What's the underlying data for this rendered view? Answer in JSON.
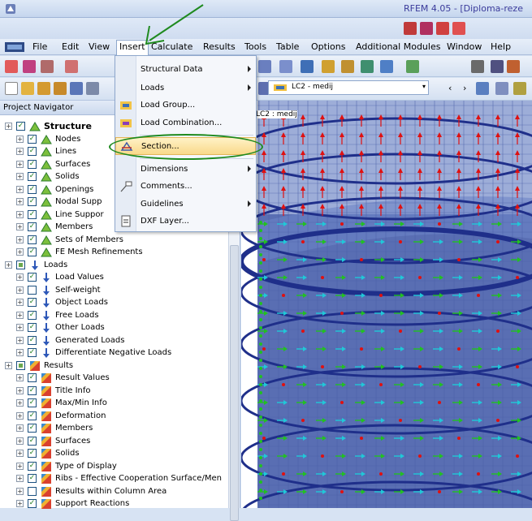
{
  "window": {
    "title": "RFEM 4.05 - [Diploma-reze"
  },
  "menubar": {
    "items": [
      {
        "label": "File"
      },
      {
        "label": "Edit"
      },
      {
        "label": "View"
      },
      {
        "label": "Insert"
      },
      {
        "label": "Calculate"
      },
      {
        "label": "Results"
      },
      {
        "label": "Tools"
      },
      {
        "label": "Table"
      },
      {
        "label": "Options"
      },
      {
        "label": "Additional Modules"
      },
      {
        "label": "Window"
      },
      {
        "label": "Help"
      }
    ]
  },
  "toolbar": {
    "load_case": "LC2 - medij"
  },
  "insert_menu": {
    "items": [
      {
        "label": "Structural Data",
        "submenu": true
      },
      {
        "label": "Loads",
        "submenu": true
      },
      {
        "label": "Load Group..."
      },
      {
        "label": "Load Combination..."
      },
      {
        "label": "Section..."
      },
      {
        "label": "Dimensions",
        "submenu": true
      },
      {
        "label": "Comments..."
      },
      {
        "label": "Guidelines",
        "submenu": true
      },
      {
        "label": "DXF Layer..."
      }
    ]
  },
  "navigator": {
    "title": "Project Navigator",
    "tree": [
      {
        "label": "Structure",
        "level": 0,
        "bold": true
      },
      {
        "label": "Nodes",
        "level": 1
      },
      {
        "label": "Lines",
        "level": 1
      },
      {
        "label": "Surfaces",
        "level": 1
      },
      {
        "label": "Solids",
        "level": 1
      },
      {
        "label": "Openings",
        "level": 1
      },
      {
        "label": "Nodal Supp",
        "level": 1
      },
      {
        "label": "Line Suppor",
        "level": 1
      },
      {
        "label": "Members",
        "level": 1
      },
      {
        "label": "Sets of Members",
        "level": 1
      },
      {
        "label": "FE Mesh Refinements",
        "level": 1
      },
      {
        "label": "Loads",
        "level": 0
      },
      {
        "label": "Load Values",
        "level": 1
      },
      {
        "label": "Self-weight",
        "level": 1
      },
      {
        "label": "Object Loads",
        "level": 1
      },
      {
        "label": "Free Loads",
        "level": 1
      },
      {
        "label": "Other Loads",
        "level": 1
      },
      {
        "label": "Generated Loads",
        "level": 1
      },
      {
        "label": "Differentiate Negative Loads",
        "level": 1
      },
      {
        "label": "Results",
        "level": 0
      },
      {
        "label": "Result Values",
        "level": 1
      },
      {
        "label": "Title Info",
        "level": 1
      },
      {
        "label": "Max/Min Info",
        "level": 1
      },
      {
        "label": "Deformation",
        "level": 1
      },
      {
        "label": "Members",
        "level": 1
      },
      {
        "label": "Surfaces",
        "level": 1
      },
      {
        "label": "Solids",
        "level": 1
      },
      {
        "label": "Type of Display",
        "level": 1
      },
      {
        "label": "Ribs - Effective Cooperation Surface/Men",
        "level": 1
      },
      {
        "label": "Results within Column Area",
        "level": 1
      },
      {
        "label": "Support Reactions",
        "level": 1
      }
    ]
  },
  "viewport": {
    "label": "LC2 : medij"
  },
  "colors": {
    "mesh": "#4a5fa8",
    "ring": "#1f2f8a",
    "red_load": "#e01010",
    "green_load": "#22c022",
    "cyan_load": "#20c8d8",
    "highlight": "#1f8a1f"
  }
}
